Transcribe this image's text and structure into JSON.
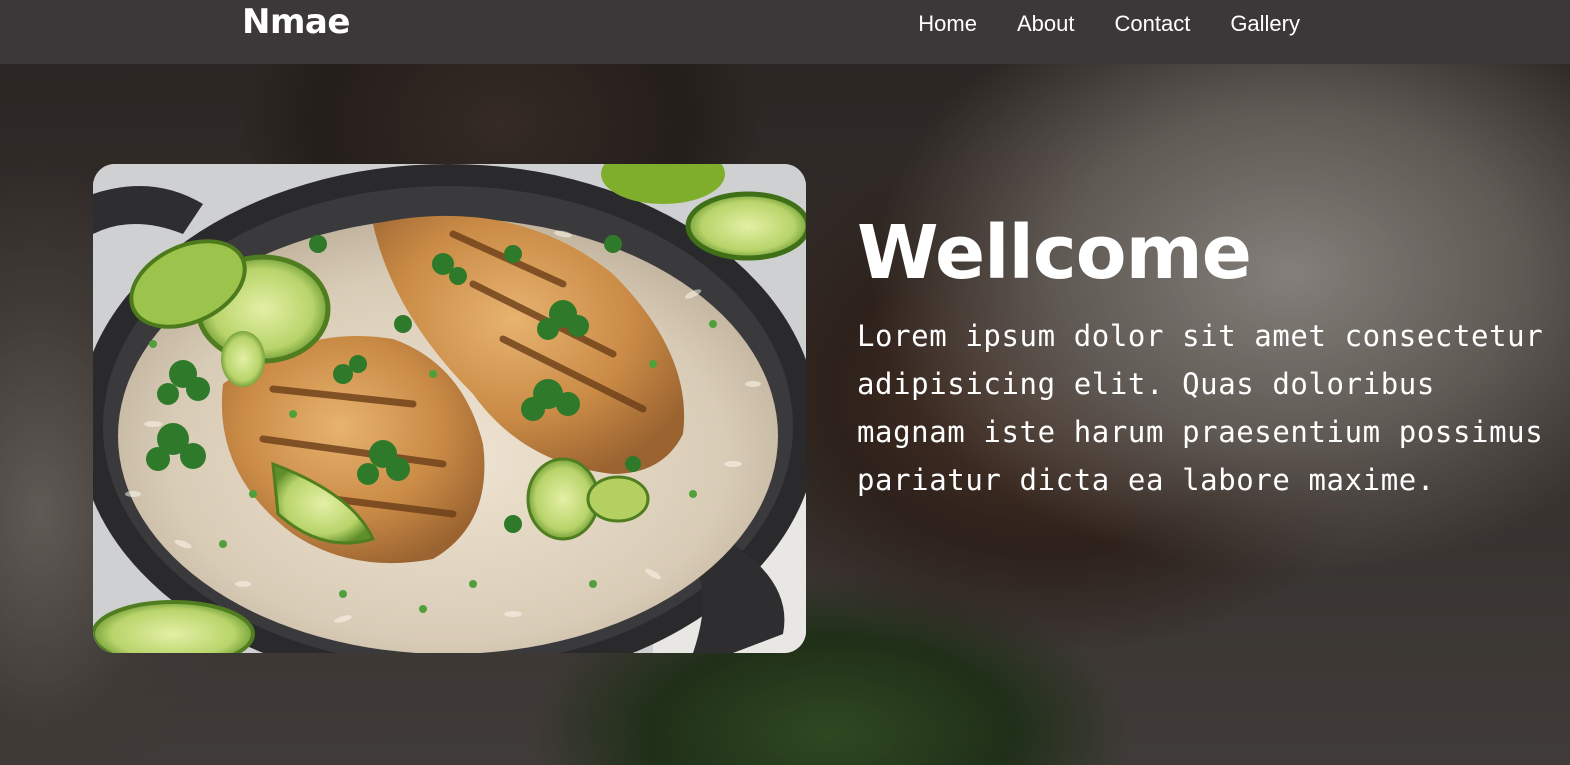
{
  "navbar": {
    "brand": "Nmae",
    "links": [
      "Home",
      "About",
      "Contact",
      "Gallery"
    ]
  },
  "hero": {
    "title": "Wellcome",
    "body": "Lorem ipsum dolor sit amet consectetur adipisicing elit. Quas doloribus magnam iste harum praesentium possimus pariatur dicta ea labore maxime."
  },
  "colors": {
    "navbar_bg": "#3c3738",
    "text": "#ffffff"
  }
}
